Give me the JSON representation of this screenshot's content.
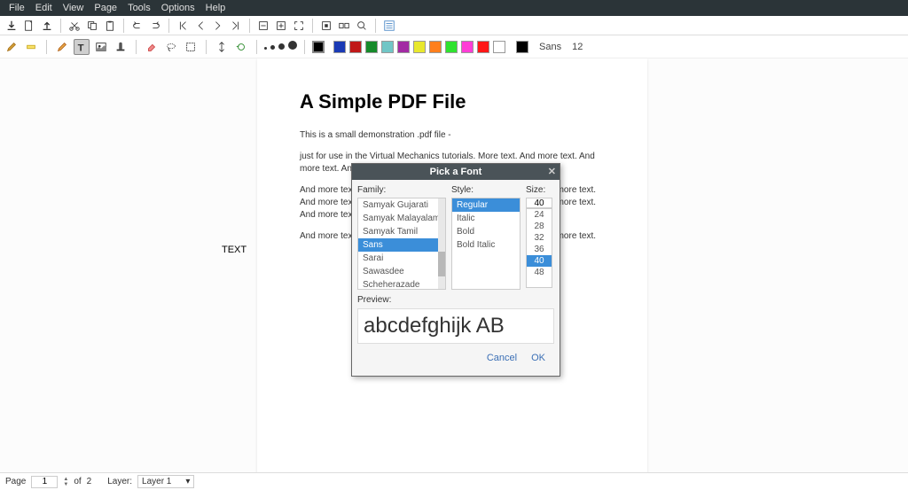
{
  "menu": {
    "items": [
      "File",
      "Edit",
      "View",
      "Page",
      "Tools",
      "Options",
      "Help"
    ]
  },
  "toolbar2_font": {
    "name": "Sans",
    "size": "12"
  },
  "doc": {
    "title": "A Simple PDF File",
    "p1": "This is a small demonstration .pdf file -",
    "p2": "just for use in the Virtual Mechanics tutorials. More text. And more text. And more text. And more text. And more text.",
    "p3": "And more text. And more text. And more text. And more text. And more text. And more text. And more text. And more text. And more text. And more text. And more text.",
    "p4": "And more text. And more text. And more text. And more text. And more text.",
    "text_object": "TEXT"
  },
  "dialog": {
    "title": "Pick a Font",
    "family_label": "Family:",
    "style_label": "Style:",
    "size_label": "Size:",
    "families": [
      "Samyak Gujarati",
      "Samyak Malayalam",
      "Samyak Tamil",
      "Sans",
      "Sarai",
      "Sawasdee",
      "Scheherazade"
    ],
    "family_selected": "Sans",
    "styles": [
      "Regular",
      "Italic",
      "Bold",
      "Bold Italic"
    ],
    "style_selected": "Regular",
    "sizes": [
      "40",
      "24",
      "28",
      "32",
      "36",
      "40",
      "48"
    ],
    "size_selected_index": 5,
    "preview_label": "Preview:",
    "preview_text": "abcdefghijk AB",
    "cancel": "Cancel",
    "ok": "OK"
  },
  "status": {
    "page_label": "Page",
    "page_current": "1",
    "page_of": "of",
    "page_total": "2",
    "layer_label": "Layer:",
    "layer_current": "Layer 1"
  },
  "swatches": [
    "#000000",
    "#1a3ab5",
    "#c01818",
    "#168a2a",
    "#70c6c6",
    "#a22aa3",
    "#e8e82d",
    "#ff7f1c",
    "#2fe22f",
    "#ff3dd6",
    "#ff1717",
    "#ffffff",
    "#000000"
  ]
}
